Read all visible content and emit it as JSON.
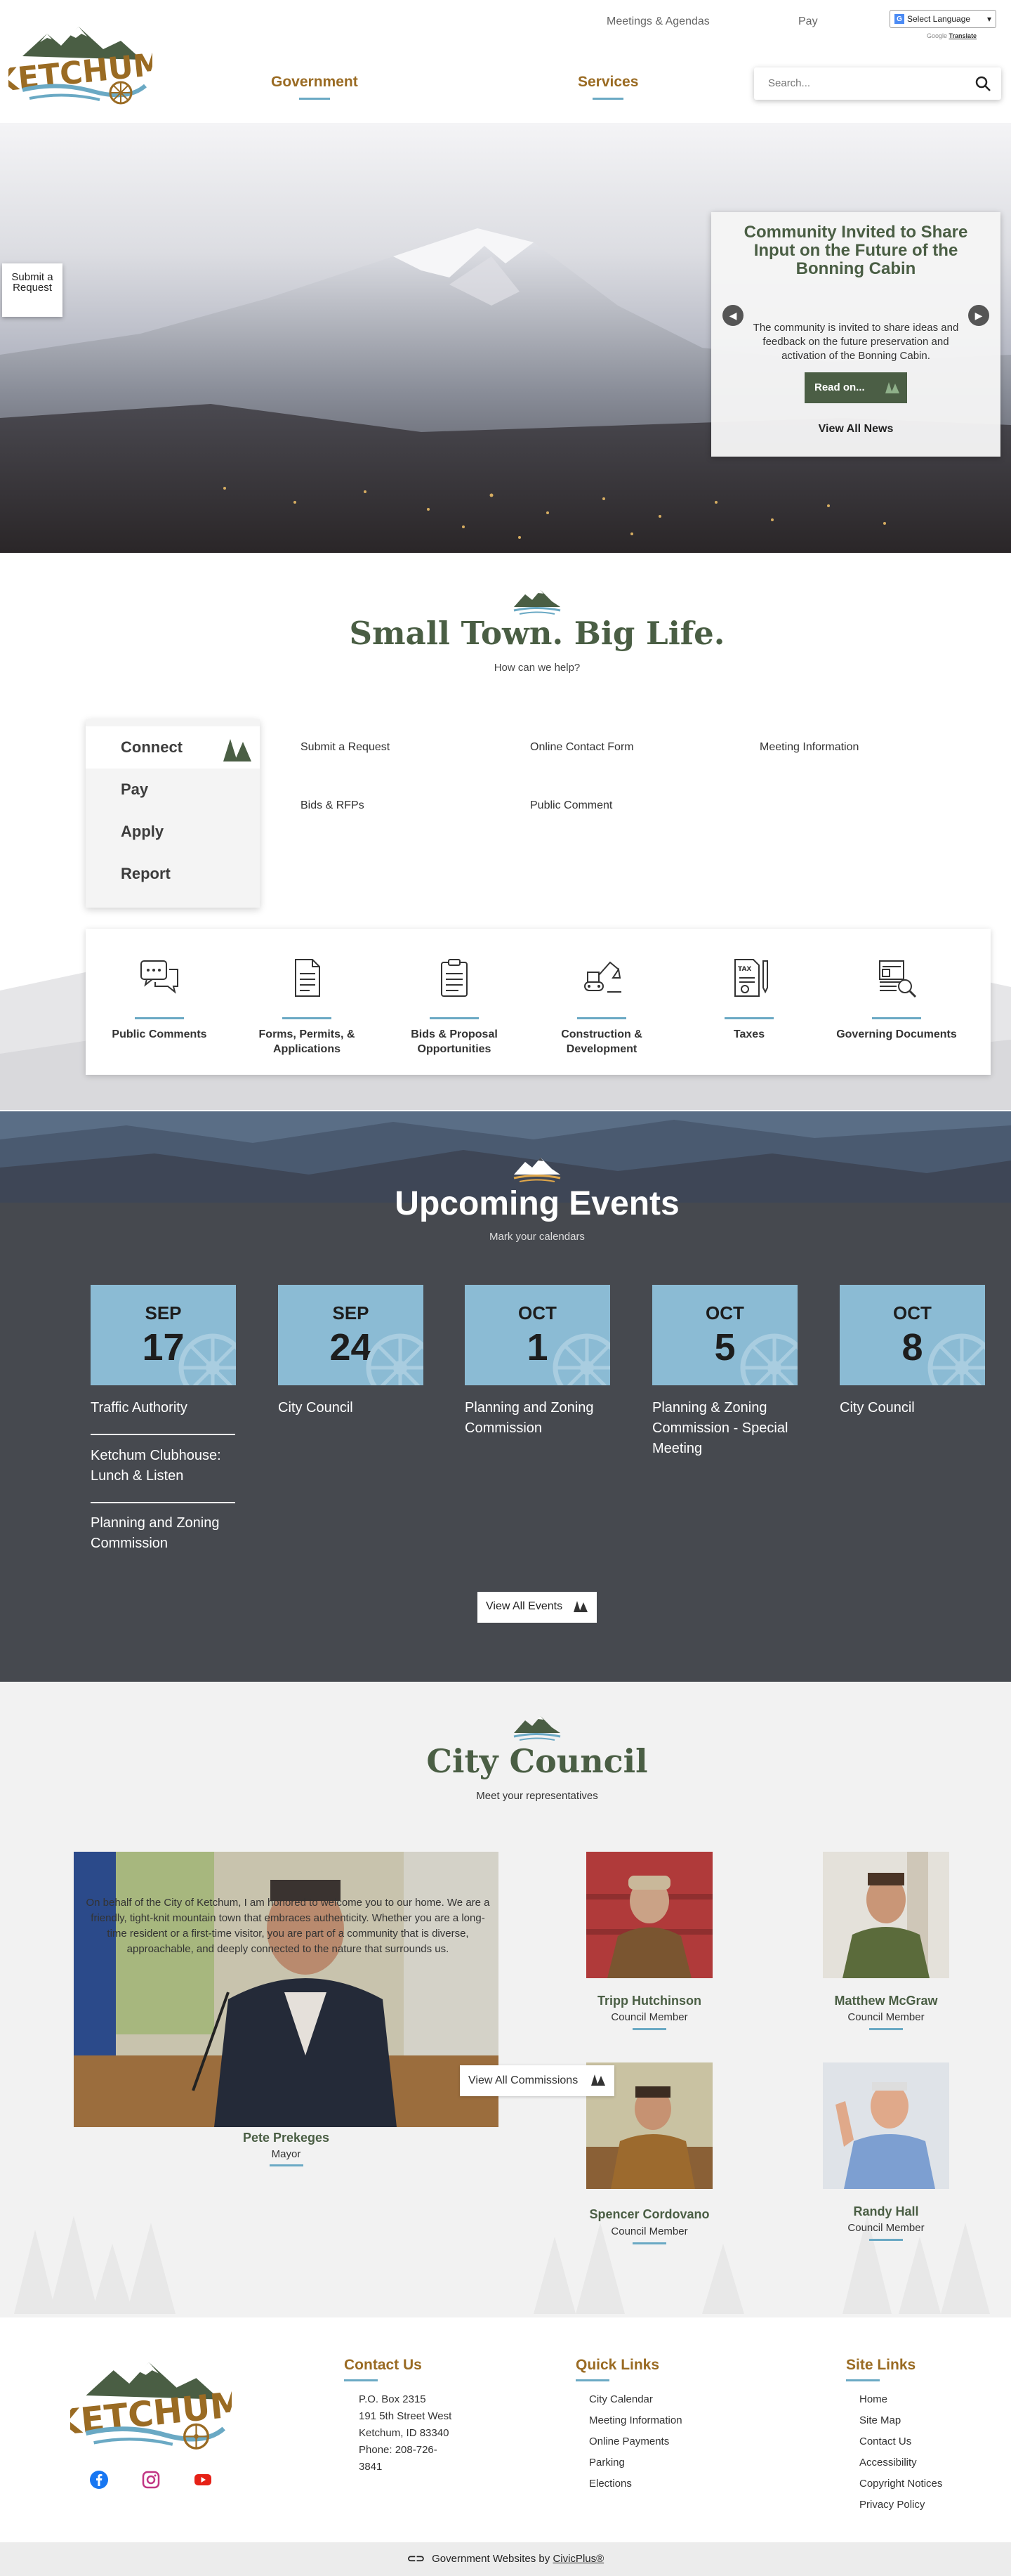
{
  "header": {
    "util_links": [
      "Meetings & Agendas",
      "Pay"
    ],
    "language_select": "Select Language",
    "powered_by": "Google",
    "translate": "Translate",
    "nav": [
      "Government",
      "Services"
    ],
    "search_placeholder": "Search...",
    "logo_text": "KETCHUM"
  },
  "hero": {
    "submit_request": "Submit a Request",
    "news_title": "Community Invited to Share Input on the Future of the Bonning Cabin",
    "news_text": "The community is invited to share ideas and feedback on the future preservation and activation of the Bonning Cabin.",
    "read_on": "Read on...",
    "view_all_news": "View All News"
  },
  "intro": {
    "title": "Small Town. Big Life.",
    "subtitle": "How can we help?",
    "menu": [
      "Connect",
      "Pay",
      "Apply",
      "Report"
    ],
    "links": [
      "Submit a Request",
      "Online Contact Form",
      "Meeting Information",
      "Bids & RFPs",
      "Public Comment"
    ]
  },
  "quick_icons": [
    {
      "label": "Public Comments",
      "icon": "chat-bubbles-icon"
    },
    {
      "label": "Forms, Permits, & Applications",
      "icon": "document-icon"
    },
    {
      "label": "Bids & Proposal Opportunities",
      "icon": "clipboard-icon"
    },
    {
      "label": "Construction & Development",
      "icon": "excavator-icon"
    },
    {
      "label": "Taxes",
      "icon": "tax-document-icon"
    },
    {
      "label": "Governing Documents",
      "icon": "documents-search-icon"
    }
  ],
  "events": {
    "title": "Upcoming Events",
    "subtitle": "Mark your calendars",
    "dates": [
      {
        "month": "SEP",
        "day": "17"
      },
      {
        "month": "SEP",
        "day": "24"
      },
      {
        "month": "OCT",
        "day": "1"
      },
      {
        "month": "OCT",
        "day": "5"
      },
      {
        "month": "OCT",
        "day": "8"
      }
    ],
    "col1": [
      "Traffic Authority",
      "Ketchum Clubhouse: Lunch & Listen",
      "Planning and Zoning Commission"
    ],
    "col2": [
      "City Council"
    ],
    "col3": [
      "Planning and Zoning Commission"
    ],
    "col4": [
      "Planning & Zoning Commission - Special Meeting"
    ],
    "col5": [
      "City Council"
    ],
    "view_all": "View All Events"
  },
  "council": {
    "title": "City Council",
    "subtitle": "Meet your representatives",
    "mayor": {
      "name": "Pete Prekeges",
      "role": "Mayor",
      "text": "On behalf of the City of Ketchum, I am honored to welcome you to our home. We are a friendly, tight-knit mountain town that embraces authenticity. Whether you are a long-time resident or a first-time visitor, you are part of a community that is diverse, approachable, and deeply connected to the nature that surrounds us."
    },
    "members": [
      {
        "name": "Tripp Hutchinson",
        "role": "Council Member"
      },
      {
        "name": "Matthew McGraw",
        "role": "Council Member"
      },
      {
        "name": "Spencer Cordovano",
        "role": "Council Member"
      },
      {
        "name": "Randy Hall",
        "role": "Council Member"
      }
    ],
    "view_all": "View All Commissions"
  },
  "footer": {
    "contact_head": "Contact Us",
    "contact_lines": [
      "P.O. Box 2315",
      "191 5th Street West",
      "Ketchum, ID 83340",
      "Phone: 208-726-",
      "3841"
    ],
    "quick_head": "Quick Links",
    "quick_links": [
      "City Calendar",
      "Meeting Information",
      "Online Payments",
      "Parking",
      "Elections"
    ],
    "site_head": "Site Links",
    "site_links": [
      "Home",
      "Site Map",
      "Contact Us",
      "Accessibility",
      "Copyright Notices",
      "Privacy Policy"
    ],
    "bottom_text": "Government Websites by",
    "bottom_link": "CivicPlus®"
  }
}
